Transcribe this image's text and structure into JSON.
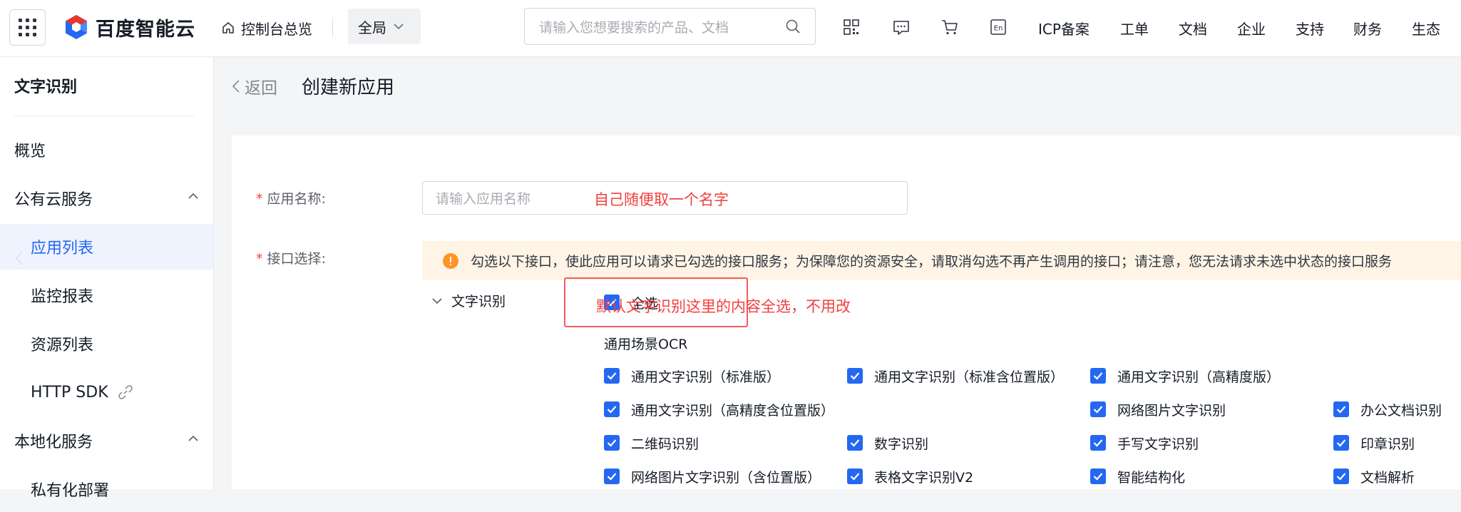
{
  "topbar": {
    "logo_text": "百度智能云",
    "console_home": "控制台总览",
    "scope_value": "全局",
    "search_placeholder": "请输入您想要搜索的产品、文档",
    "nav_items": [
      "ICP备案",
      "工单",
      "文档",
      "企业",
      "支持",
      "财务",
      "生态"
    ],
    "icons": [
      "qrcode-icon",
      "message-icon",
      "cart-icon",
      "language-en-icon"
    ]
  },
  "sidebar": {
    "title": "文字识别",
    "overview": "概览",
    "public_cloud": "公有云服务",
    "app_list": "应用列表",
    "monitor_report": "监控报表",
    "resource_list": "资源列表",
    "http_sdk": "HTTP SDK",
    "local_service": "本地化服务",
    "private_deploy": "私有化部署"
  },
  "header": {
    "back_label": "返回",
    "page_title": "创建新应用"
  },
  "form": {
    "app_name_label": "应用名称:",
    "app_name_placeholder": "请输入应用名称",
    "app_name_annotation": "自己随便取一个名字",
    "api_select_label": "接口选择:",
    "notice_text": "勾选以下接口，使此应用可以请求已勾选的接口服务；为保障您的资源安全，请取消勾选不再产生调用的接口；请注意，您无法请求未选中状态的接口服务",
    "category": "文字识别",
    "select_all": "全选",
    "select_all_annotation": "默认文字识别这里的内容全选，不用改",
    "section_title": "通用场景OCR",
    "options": [
      "通用文字识别（标准版）",
      "通用文字识别（标准含位置版）",
      "通用文字识别（高精度版）",
      "通用文字识别（高精度含位置版）",
      "网络图片文字识别",
      "办公文档识别",
      "二维码识别",
      "数字识别",
      "手写文字识别",
      "印章识别",
      "网络图片文字识别（含位置版）",
      "表格文字识别V2",
      "智能结构化",
      "文档解析"
    ]
  },
  "colors": {
    "primary": "#2468f2",
    "annotation_red": "#f33e3e",
    "notice_bg": "#fff4e6",
    "warning_orange": "#ff9326"
  }
}
